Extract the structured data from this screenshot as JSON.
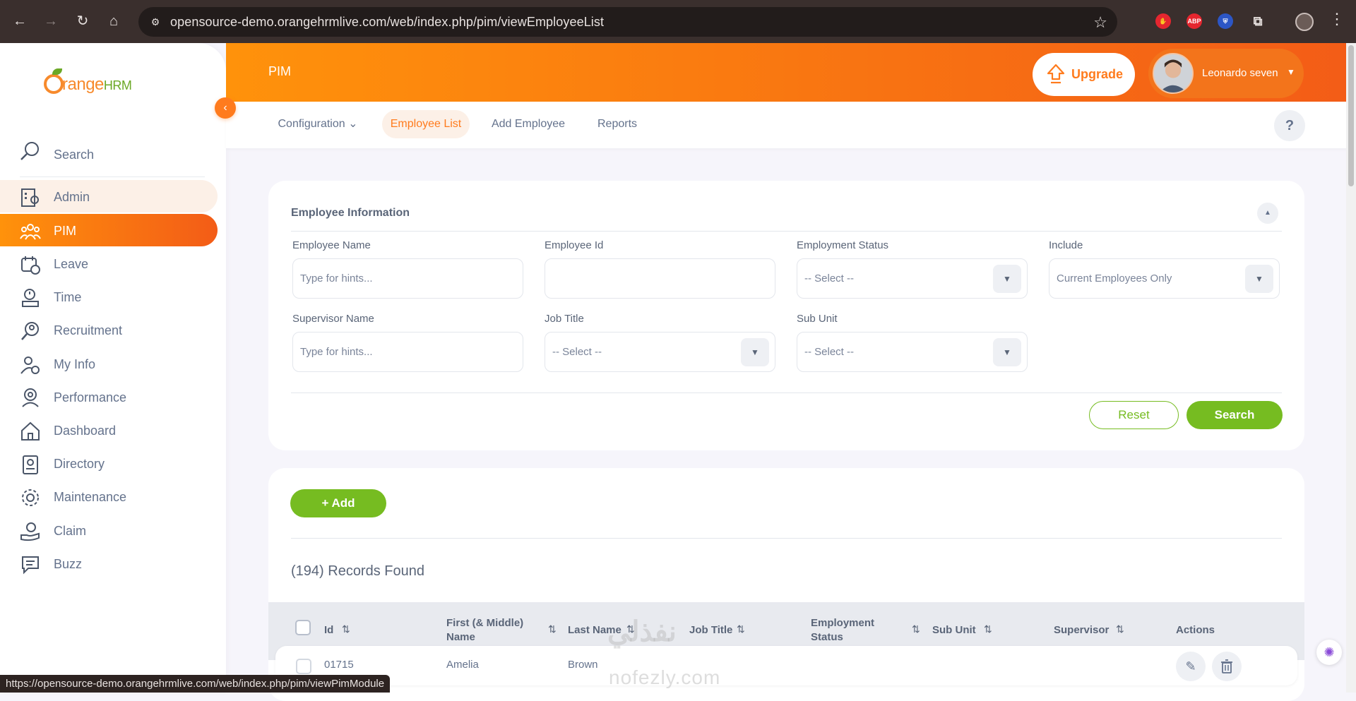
{
  "browser": {
    "url": "opensource-demo.orangehrmlive.com/web/index.php/pim/viewEmployeeList",
    "status_url": "https://opensource-demo.orangehrmlive.com/web/index.php/pim/viewPimModule",
    "extensions": [
      "ABP"
    ]
  },
  "logo": {
    "orange": "range",
    "hrm": "HRM"
  },
  "sidebar": {
    "search_label": "Search",
    "items": [
      {
        "label": "Admin"
      },
      {
        "label": "PIM"
      },
      {
        "label": "Leave"
      },
      {
        "label": "Time"
      },
      {
        "label": "Recruitment"
      },
      {
        "label": "My Info"
      },
      {
        "label": "Performance"
      },
      {
        "label": "Dashboard"
      },
      {
        "label": "Directory"
      },
      {
        "label": "Maintenance"
      },
      {
        "label": "Claim"
      },
      {
        "label": "Buzz"
      }
    ]
  },
  "header": {
    "module": "PIM",
    "upgrade_label": "Upgrade",
    "user_name": "Leonardo seven"
  },
  "tabs": [
    "Configuration",
    "Employee List",
    "Add Employee",
    "Reports"
  ],
  "help_label": "?",
  "filter": {
    "title": "Employee Information",
    "fields": {
      "employee_name": {
        "label": "Employee Name",
        "placeholder": "Type for hints..."
      },
      "employee_id": {
        "label": "Employee Id",
        "value": ""
      },
      "employment_status": {
        "label": "Employment Status",
        "value": "-- Select --"
      },
      "include": {
        "label": "Include",
        "value": "Current Employees Only"
      },
      "supervisor_name": {
        "label": "Supervisor Name",
        "placeholder": "Type for hints..."
      },
      "job_title": {
        "label": "Job Title",
        "value": "-- Select --"
      },
      "sub_unit": {
        "label": "Sub Unit",
        "value": "-- Select --"
      }
    },
    "reset_label": "Reset",
    "search_label": "Search"
  },
  "list": {
    "add_label": "Add",
    "records": "(194) Records Found",
    "columns": {
      "id": "Id",
      "first_name_1": "First (& Middle)",
      "first_name_2": "Name",
      "last_name": "Last Name",
      "job_title": "Job Title",
      "emp_status_1": "Employment",
      "emp_status_2": "Status",
      "sub_unit": "Sub Unit",
      "supervisor": "Supervisor",
      "actions": "Actions"
    },
    "rows": [
      {
        "id": "01715",
        "first_name": "Amelia",
        "last_name": "Brown",
        "job_title": "",
        "status": "",
        "sub_unit": "",
        "supervisor": ""
      }
    ]
  },
  "watermark": {
    "arabic": "نفذلي",
    "latin": "nofezly.com"
  },
  "colors": {
    "accent": "#ff7b1d",
    "green": "#76bc21",
    "text": "#64728c"
  }
}
